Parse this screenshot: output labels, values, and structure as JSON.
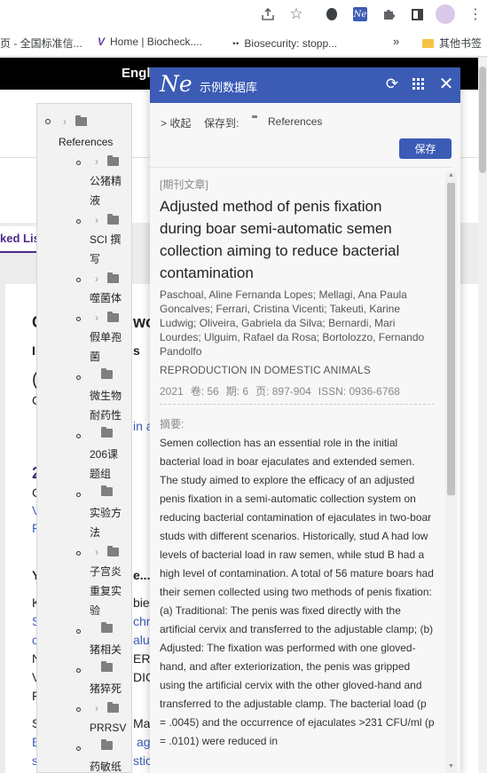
{
  "browser": {
    "bookmarks": [
      {
        "label": "页 - 全国标准信..."
      },
      {
        "label": "Home | Biocheck...."
      },
      {
        "label": "Biosecurity: stopp..."
      }
    ],
    "more_symbol": "»",
    "other_bookmarks": "其他书签",
    "icons": [
      "share-icon",
      "star-icon",
      "evernote-icon",
      "ne-extension-icon",
      "puzzle-icon",
      "side-panel-icon",
      "avatar",
      "kebab-menu-icon"
    ],
    "ext_badge": "Ne"
  },
  "background_page": {
    "topbar_text": "Engl",
    "side_tab": "ked Lis",
    "fragments": [
      "C",
      "wo",
      "I",
      "s",
      "(",
      "C",
      "in al",
      "2",
      "C",
      "V",
      "F",
      "Y",
      "e...",
      "K",
      "bie",
      "S",
      "chr",
      "c",
      "alu",
      "N",
      "ERY",
      "V",
      "DIC",
      "F",
      "S",
      "Ma",
      "E",
      "ag",
      "s",
      "stic"
    ]
  },
  "tree": {
    "root_label": "References",
    "items": [
      {
        "label": "公猪精液",
        "has_children": true
      },
      {
        "label": "SCI 撰写",
        "has_children": true
      },
      {
        "label": "噬菌体",
        "has_children": true
      },
      {
        "label": "假单孢菌",
        "has_children": true
      },
      {
        "label": "微生物耐药性",
        "has_children": false
      },
      {
        "label": "206课题组",
        "has_children": false
      },
      {
        "label": "实验方法",
        "has_children": false
      },
      {
        "label": "子宫炎重复实验",
        "has_children": true
      },
      {
        "label": "猪相关",
        "has_children": false
      },
      {
        "label": "猪猝死",
        "has_children": false
      },
      {
        "label": "PRRSV",
        "has_children": true
      },
      {
        "label": "药敏纸",
        "has_children": false
      }
    ]
  },
  "popup": {
    "logo": "Ne",
    "title": "示例数据库",
    "collapse_label": "> 收起",
    "save_to_label": "保存到:",
    "save_to_folder": "References",
    "save_button": "保存",
    "article": {
      "type_tag": "[期刊文章]",
      "title": "Adjusted method of penis fixation during boar semi-automatic semen collection aiming to reduce bacterial contamination",
      "authors": "Paschoal, Aline Fernanda Lopes; Mellagi, Ana Paula Goncalves; Ferrari, Cristina Vicenti; Takeuti, Karine Ludwig; Oliveira, Gabriela da Silva; Bernardi, Mari Lourdes; Ulguim, Rafael da Rosa; Bortolozzo, Fernando Pandolfo",
      "journal": "REPRODUCTION IN DOMESTIC ANIMALS",
      "year": "2021",
      "volume": "卷: 56",
      "issue": "期: 6",
      "pages": "页: 897-904",
      "issn": "ISSN: 0936-6768",
      "abstract_label": "摘要:",
      "abstract": "Semen collection has an essential role in the initial bacterial load in boar ejaculates and extended semen. The study aimed to explore the efficacy of an adjusted penis fixation in a semi-automatic collection system on reducing bacterial contamination of ejaculates in two-boar studs with different scenarios. Historically, stud A had low levels of bacterial load in raw semen, while stud B had a high level of contamination. A total of 56 mature boars had their semen collected using two methods of penis fixation: (a) Traditional: The penis was fixed directly with the artificial cervix and transferred to the adjustable clamp; (b) Adjusted: The fixation was performed with one gloved-hand, and after exteriorization, the penis was gripped using the artificial cervix with the other gloved-hand and transferred to the adjustable clamp. The bacterial load (p = .0045) and the occurrence of ejaculates >231 CFU/ml (p = .0101) were reduced in"
    }
  }
}
